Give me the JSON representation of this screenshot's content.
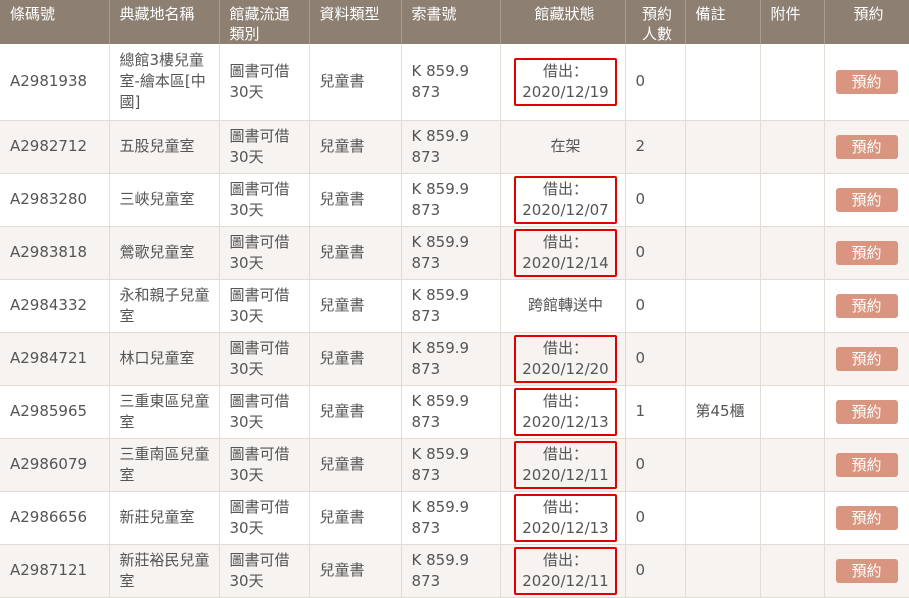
{
  "headers": [
    "條碼號",
    "典藏地名稱",
    "館藏流通類別",
    "資料類型",
    "索書號",
    "館藏狀態",
    "預約人數",
    "備註",
    "附件",
    "預約"
  ],
  "header_lines": {
    "circ": [
      "館藏流通",
      "類別"
    ],
    "holds": [
      "預約",
      "人數"
    ]
  },
  "reserve_label": "預約",
  "rows": [
    {
      "barcode": "A2981938",
      "location": "總館3樓兒童室-繪本區[中國]",
      "circ": "圖書可借30天",
      "type": "兒童書",
      "call": "K 859.9 873",
      "status_l1": "借出：",
      "status_l2": "2020/12/19",
      "holds": "0",
      "note": ""
    },
    {
      "barcode": "A2982712",
      "location": "五股兒童室",
      "circ": "圖書可借30天",
      "type": "兒童書",
      "call": "K 859.9 873",
      "status_l1": "在架",
      "status_l2": "",
      "holds": "2",
      "note": ""
    },
    {
      "barcode": "A2983280",
      "location": "三峽兒童室",
      "circ": "圖書可借30天",
      "type": "兒童書",
      "call": "K 859.9 873",
      "status_l1": "借出：",
      "status_l2": "2020/12/07",
      "holds": "0",
      "note": ""
    },
    {
      "barcode": "A2983818",
      "location": "鶯歌兒童室",
      "circ": "圖書可借30天",
      "type": "兒童書",
      "call": "K 859.9 873",
      "status_l1": "借出：",
      "status_l2": "2020/12/14",
      "holds": "0",
      "note": ""
    },
    {
      "barcode": "A2984332",
      "location": "永和親子兒童室",
      "circ": "圖書可借30天",
      "type": "兒童書",
      "call": "K 859.9 873",
      "status_l1": "跨館轉送中",
      "status_l2": "",
      "holds": "0",
      "note": ""
    },
    {
      "barcode": "A2984721",
      "location": "林口兒童室",
      "circ": "圖書可借30天",
      "type": "兒童書",
      "call": "K 859.9 873",
      "status_l1": "借出：",
      "status_l2": "2020/12/20",
      "holds": "0",
      "note": ""
    },
    {
      "barcode": "A2985965",
      "location": "三重東區兒童室",
      "circ": "圖書可借30天",
      "type": "兒童書",
      "call": "K 859.9 873",
      "status_l1": "借出：",
      "status_l2": "2020/12/13",
      "holds": "1",
      "note": "第45櫃"
    },
    {
      "barcode": "A2986079",
      "location": "三重南區兒童室",
      "circ": "圖書可借30天",
      "type": "兒童書",
      "call": "K 859.9 873",
      "status_l1": "借出：",
      "status_l2": "2020/12/11",
      "holds": "0",
      "note": ""
    },
    {
      "barcode": "A2986656",
      "location": "新莊兒童室",
      "circ": "圖書可借30天",
      "type": "兒童書",
      "call": "K 859.9 873",
      "status_l1": "借出：",
      "status_l2": "2020/12/13",
      "holds": "0",
      "note": ""
    },
    {
      "barcode": "A2987121",
      "location": "新莊裕民兒童室",
      "circ": "圖書可借30天",
      "type": "兒童書",
      "call": "K 859.9 873",
      "status_l1": "借出：",
      "status_l2": "2020/12/11",
      "holds": "0",
      "note": ""
    }
  ]
}
